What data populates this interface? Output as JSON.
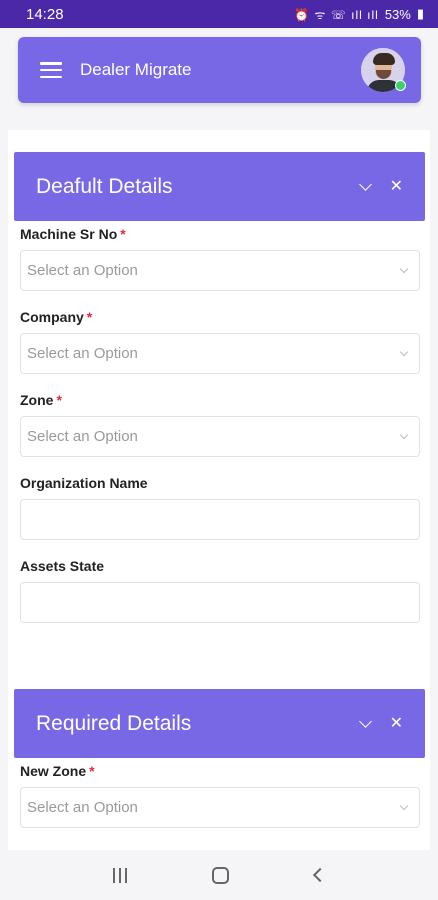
{
  "status_bar": {
    "time": "14:28",
    "icons": "⏰ ᯤ ☏ ıll ıll",
    "battery": "53%"
  },
  "header": {
    "title": "Dealer Migrate"
  },
  "sections": {
    "default": {
      "title": "Deafult Details",
      "fields": {
        "machine_sr_no": {
          "label": "Machine Sr No",
          "required": "*",
          "placeholder": "Select an Option"
        },
        "company": {
          "label": "Company",
          "required": "*",
          "placeholder": "Select an Option"
        },
        "zone": {
          "label": "Zone",
          "required": "*",
          "placeholder": "Select an Option"
        },
        "organization_name": {
          "label": "Organization Name",
          "value": ""
        },
        "assets_state": {
          "label": "Assets State",
          "value": ""
        }
      }
    },
    "required": {
      "title": "Required Details",
      "fields": {
        "new_zone": {
          "label": "New Zone",
          "required": "*",
          "placeholder": "Select an Option"
        }
      }
    }
  },
  "colors": {
    "accent": "#7868e6",
    "status_bar": "#4a28a8",
    "required": "#e02d3c",
    "online": "#3ccf6e"
  }
}
